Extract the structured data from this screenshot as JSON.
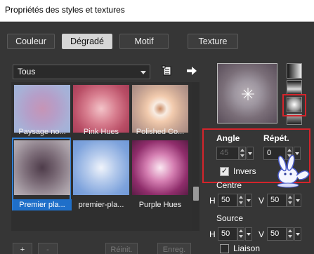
{
  "window": {
    "title": "Propriétés des styles et textures"
  },
  "tabs": [
    {
      "label": "Couleur",
      "active": false
    },
    {
      "label": "Dégradé",
      "active": true
    },
    {
      "label": "Motif",
      "active": false
    },
    {
      "label": "Texture",
      "active": false
    }
  ],
  "filter": {
    "selected": "Tous"
  },
  "gradients": [
    {
      "label": "Paysage no...",
      "selected": false
    },
    {
      "label": "Pink Hues",
      "selected": false
    },
    {
      "label": "Polished Co...",
      "selected": false
    },
    {
      "label": "Premier pla...",
      "selected": true
    },
    {
      "label": "premier-pla...",
      "selected": false
    },
    {
      "label": "Purple Hues",
      "selected": false
    }
  ],
  "bottom_buttons": {
    "add": "+",
    "remove": "-",
    "reset": "Réinit.",
    "save": "Enreg."
  },
  "properties": {
    "angle_label": "Angle",
    "angle_value": "45",
    "repeat_label": "Répét.",
    "repeat_value": "0",
    "invert_label": "Invers",
    "invert_checked": true,
    "center_label": "Centre",
    "center_h_label": "H",
    "center_h": "50",
    "center_v_label": "V",
    "center_v": "50",
    "source_label": "Source",
    "source_h_label": "H",
    "source_h": "50",
    "source_v_label": "V",
    "source_v": "50",
    "link_label": "Liaison",
    "link_checked": false
  },
  "colors": {
    "accent": "#1f6fc9",
    "highlight_box": "#d4242b",
    "tab_active_bg": "#d6d6d6"
  }
}
